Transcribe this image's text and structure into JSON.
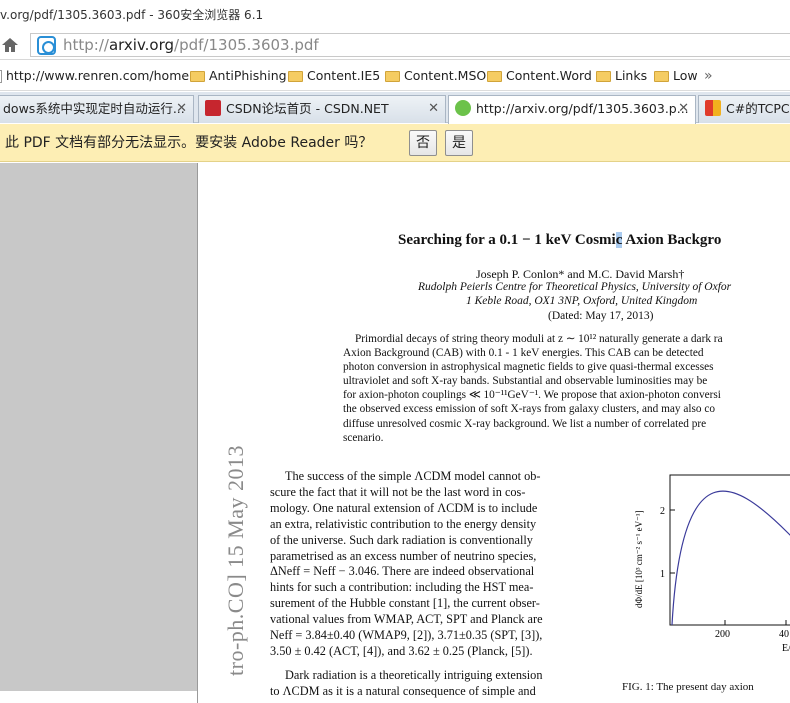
{
  "window": {
    "title": "v.org/pdf/1305.3603.pdf - 360安全浏览器 6.1"
  },
  "address": {
    "prefix": "http://",
    "domain": "arxiv.org",
    "path": "/pdf/1305.3603.pdf"
  },
  "favorites": [
    {
      "label": "http://www.renren.com/home",
      "icon": "page-icon"
    },
    {
      "label": "AntiPhishing",
      "icon": "folder-icon"
    },
    {
      "label": "Content.IE5",
      "icon": "folder-icon"
    },
    {
      "label": "Content.MSO",
      "icon": "folder-icon"
    },
    {
      "label": "Content.Word",
      "icon": "folder-icon"
    },
    {
      "label": "Links",
      "icon": "folder-icon"
    },
    {
      "label": "Low",
      "icon": "folder-icon"
    }
  ],
  "favorites_more": "»",
  "tabs": [
    {
      "label": "dows系统中实现定时自动运行...",
      "close": "✕"
    },
    {
      "label": "CSDN论坛首页 - CSDN.NET",
      "close": "✕"
    },
    {
      "label": "http://arxiv.org/pdf/1305.3603.p...",
      "close": "✕"
    },
    {
      "label": "C#的TCPCli"
    }
  ],
  "notice": {
    "text": "此 PDF 文档有部分无法显示。要安装 Adobe Reader 吗？",
    "no": "否",
    "yes": "是"
  },
  "paper": {
    "side_stamp": "tro-ph.CO]  15 May 2013",
    "title_a": "Searching for a 0.1 − 1 keV Cosmi",
    "title_hl": "c",
    "title_b": " Axion Backgro",
    "authors": "Joseph P. Conlon* and M.C. David Marsh†",
    "affil1": "Rudolph Peierls Centre for Theoretical Physics, University of Oxfor",
    "affil2": "1 Keble Road, OX1 3NP, Oxford, United Kingdom",
    "dated": "(Dated: May 17, 2013)",
    "abstract": [
      "Primordial decays of string theory moduli at z ∼ 10¹² naturally generate a dark ra",
      "Axion Background (CAB) with 0.1 - 1 keV energies.  This CAB can be detected",
      "photon conversion in astrophysical magnetic fields to give quasi-thermal excesses",
      "ultraviolet and soft X-ray bands.  Substantial and observable luminosities may be",
      "for axion-photon couplings ≪ 10⁻¹¹GeV⁻¹. We propose that axion-photon conversi",
      "the observed excess emission of soft X-rays from galaxy clusters, and may also co",
      "diffuse unresolved cosmic X-ray background.  We list a number of correlated pre",
      "scenario."
    ],
    "body": [
      "The success of the simple ΛCDM model cannot ob-",
      "scure the fact that it will not be the last word in cos-",
      "mology.  One natural extension of ΛCDM is to include",
      "an extra, relativistic contribution to the energy density",
      "of the universe.   Such dark radiation is conventionally",
      "parametrised as an excess number of neutrino species,",
      "ΔNeff = Neff − 3.046.  There are indeed observational",
      "hints for such a contribution:  including the HST mea-",
      "surement of the Hubble constant [1], the current obser-",
      "vational values from WMAP, ACT, SPT and Planck are",
      "Neff = 3.84±0.40 (WMAP9, [2]), 3.71±0.35 (SPT, [3]),",
      "3.50 ± 0.42 (ACT, [4]), and 3.62 ± 0.25 (Planck, [5]).",
      "",
      "Dark radiation is a theoretically intriguing extension",
      "to ΛCDM as it is a natural consequence of simple and"
    ],
    "figure": {
      "ylabel": "dΦ/dE  [10³ cm⁻² s⁻¹ eV⁻¹]",
      "yticks": [
        "2",
        "1"
      ],
      "xticks": [
        "200",
        "40"
      ],
      "xlabel": "E/",
      "caption": "FIG. 1:  The present day axion"
    }
  },
  "colors": {
    "notice_bg": "#fdeeb4",
    "viewer_bg": "#c8c8c8",
    "curve": "#3a3a9a"
  }
}
